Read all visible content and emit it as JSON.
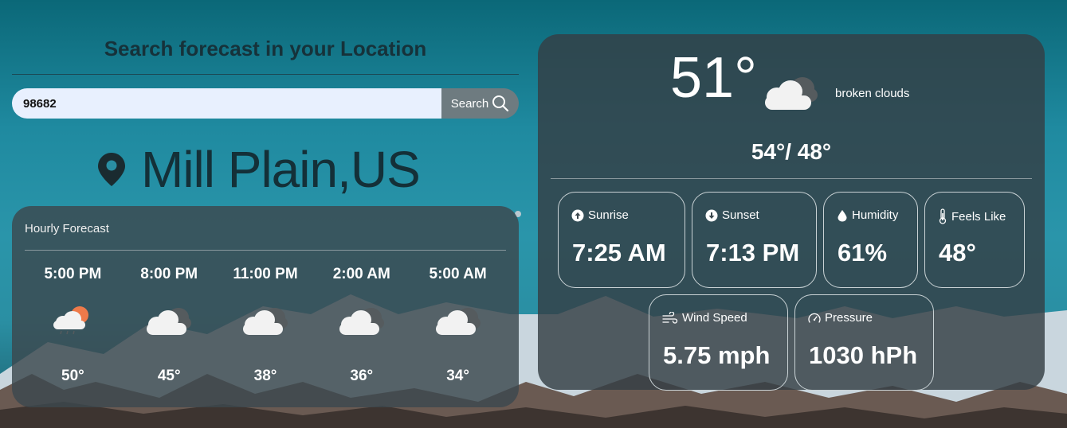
{
  "search": {
    "title": "Search forecast in your Location",
    "input_value": "98682",
    "button_label": "Search"
  },
  "location": {
    "name": "Mill Plain,US"
  },
  "hourly": {
    "title": "Hourly Forecast",
    "items": [
      {
        "time": "5:00 PM",
        "icon": "partly-cloudy-rain-icon",
        "temp": "50°"
      },
      {
        "time": "8:00 PM",
        "icon": "broken-clouds-icon",
        "temp": "45°"
      },
      {
        "time": "11:00 PM",
        "icon": "broken-clouds-icon",
        "temp": "38°"
      },
      {
        "time": "2:00 AM",
        "icon": "broken-clouds-icon",
        "temp": "36°"
      },
      {
        "time": "5:00 AM",
        "icon": "broken-clouds-icon",
        "temp": "34°"
      }
    ]
  },
  "current": {
    "temp": "51°",
    "icon": "broken-clouds-icon",
    "description": "broken clouds",
    "hilo": "54°/ 48°"
  },
  "stats": {
    "sunrise": {
      "label": "Sunrise",
      "value": "7:25 AM",
      "icon": "arrow-up-circle-icon"
    },
    "sunset": {
      "label": "Sunset",
      "value": "7:13 PM",
      "icon": "arrow-down-circle-icon"
    },
    "humidity": {
      "label": "Humidity",
      "value": "61%",
      "icon": "droplet-icon"
    },
    "feels_like": {
      "label": "Feels Like",
      "value": "48°",
      "icon": "thermometer-icon"
    },
    "wind_speed": {
      "label": "Wind Speed",
      "value": "5.75 mph",
      "icon": "wind-icon"
    },
    "pressure": {
      "label": "Pressure",
      "value": "1030 hPh",
      "icon": "gauge-icon"
    }
  },
  "colors": {
    "card_bg": "#3c484e",
    "sun": "#ee7a4a",
    "cloud_light": "#f2f2f2",
    "cloud_dark": "#555b5e"
  }
}
